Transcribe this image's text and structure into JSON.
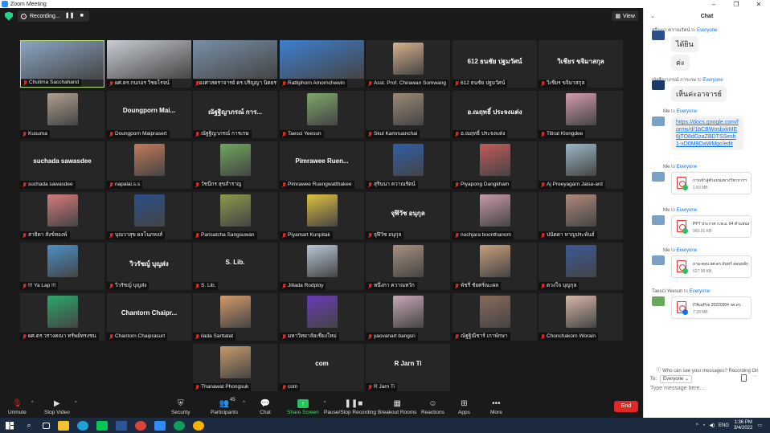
{
  "window": {
    "title": "Zoom Meeting"
  },
  "topbar": {
    "recording_label": "Recording...",
    "view_label": "View"
  },
  "participants": [
    {
      "name": "Chutima Sacchahand",
      "color": "#8aa6c4",
      "active": true
    },
    {
      "name": "ผศ.ดร.กนกอร วิชยโรจน์",
      "color": "#c9cdd4"
    },
    {
      "name": "รองศาสตราจารย์ ดร.ปริญญา นิตยรายา",
      "color": "#7890a8"
    },
    {
      "name": "Rattiphorn Amornchewin",
      "color": "#3d7fd1"
    },
    {
      "name": "Asst. Prof. Chirawan Somwang",
      "color": "#d8b08c"
    },
    {
      "name": "612 ธนชัย ปฐมวัศน์",
      "display": "612 ธนชัย ปฐมวัศน์"
    },
    {
      "name": "วิเชียร ขจิมาสกุล",
      "display": "วิเชียร ขจิมาสกุล"
    },
    {
      "name": "Kusuma",
      "color": "#b0a08e"
    },
    {
      "name": "Doungporn Maiprasert",
      "display": "Doungporn Mai..."
    },
    {
      "name": "ณัฐฐิญาภรณ์ การเกษ",
      "display": "ณัฐฐิญาภรณ์ การ..."
    },
    {
      "name": "Taesci Yeesun",
      "color": "#7fa86a"
    },
    {
      "name": "Skul Kamnuanchai",
      "color": "#9c8a74"
    },
    {
      "name": "อ.ณฤทธิ์ ประจงแต่ง",
      "display": "อ.ณฤทธิ์ ประจงแต่ง"
    },
    {
      "name": "Titirat Klongdee",
      "color": "#d49bb0"
    },
    {
      "name": "suchada sawasdee",
      "display": "suchada sawasdee"
    },
    {
      "name": "napalai.s.s",
      "color": "#c47a5a"
    },
    {
      "name": "วัชนีกร สุขสำราญ",
      "color": "#6fa85c"
    },
    {
      "name": "Pimrawee Ruengwatthakee",
      "display": "Pimrawee Ruen..."
    },
    {
      "name": "สุรินนา ควาณรัตน์",
      "color": "#2f5fa8"
    },
    {
      "name": "Piyapong Dangkham",
      "color": "#c45a5a"
    },
    {
      "name": "Aj Preeyagarn Jaisa-ard",
      "color": "#9bb8c8"
    },
    {
      "name": "สาธิดา สังข์ทองพ์",
      "color": "#d67a7a"
    },
    {
      "name": "บุณวาสุข ผลโนภหงส์",
      "color": "#2a4f8c"
    },
    {
      "name": "Parisatcha Sangsuwan",
      "color": "#8a9a4a"
    },
    {
      "name": "Piyamart Kunpitak",
      "color": "#e0c040"
    },
    {
      "name": "จุฬิวัช อนุกุล",
      "display": "จุฬิวัช อนุกุล"
    },
    {
      "name": "nuchjara boonthanom",
      "color": "#c89aa8"
    },
    {
      "name": "ปนัดดา หาญประพันธ์",
      "color": "#b08a7a"
    },
    {
      "name": "!!! Ya Lap !!!",
      "color": "#4a90c8"
    },
    {
      "name": "วิวรัชญ์ บุญส่ง",
      "display": "วิวรัชญ์ บุญส่ง"
    },
    {
      "name": "S. Lib.",
      "display": "S. Lib."
    },
    {
      "name": "Jitlada Rodploy",
      "color": "#b8c8d8"
    },
    {
      "name": "หนึ่งกา ควาณหวัก",
      "color": "#a89080"
    },
    {
      "name": "พัชรี ชัยศร์ณะผล",
      "color": "#c8a07a"
    },
    {
      "name": "ดวงใจ บุญกุล",
      "color": "#3a5a9a"
    },
    {
      "name": "ผศ.ดร.วรางคณา ทรัพย์ทรงชน",
      "color": "#2aa86a"
    },
    {
      "name": "Chantorn Chaiprasurt",
      "display": "Chantorn Chaipr..."
    },
    {
      "name": "ilada Sarttatat",
      "color": "#d49a6a"
    },
    {
      "name": "มหาวิทยาลัยเชียงใหม่",
      "color": "#6a3ab8"
    },
    {
      "name": "yaovanart bangsri",
      "color": "#c8a8b8"
    },
    {
      "name": "ณัฐฐิณีชาร์ เกาพักษา",
      "color": "#8a6a5a"
    },
    {
      "name": "Chonchakorn Worain",
      "color": "#d8b8a8"
    },
    {
      "name": "Thanawat Phongsuk",
      "color": "#c89a6a"
    },
    {
      "name": "com",
      "display": "com"
    },
    {
      "name": "R Jarn Ti",
      "display": "R Jarn Ti"
    }
  ],
  "toolbar": {
    "unmute": "Unmute",
    "stop_video": "Stop Video",
    "security": "Security",
    "participants": "Participants",
    "participants_count": "45",
    "chat": "Chat",
    "share_screen": "Share Screen",
    "pause_recording": "Pause/Stop Recording",
    "breakout_rooms": "Breakout Rooms",
    "reactions": "Reactions",
    "apps": "Apps",
    "more": "More",
    "end": "End"
  },
  "chat": {
    "title": "Chat",
    "messages": [
      {
        "from": "สุรินนา ควาณรัตน์",
        "to": "to",
        "target": "Everyone",
        "lines": [
          "ได้ยิน",
          "ค่ะ"
        ]
      },
      {
        "from": "ณัฐฐิญาภรณ์ การเกษ",
        "to": "to",
        "target": "Everyone",
        "lines": [
          "เห็นค่ะอาจารย์"
        ]
      },
      {
        "from": "Me",
        "to": "to",
        "target": "Everyone",
        "link": "https://docs.google.com/forms/d/1bCBWosbxkME6jTO8dGzaZBDTSSesh1-xD0M9OaWMgc/edit"
      },
      {
        "from": "Me",
        "to": "to",
        "target": "Everyone",
        "file": "การเข้าสู่ตำแหน่งทางวิชาการฯ",
        "size": "1.83 MB"
      },
      {
        "from": "Me",
        "to": "to",
        "target": "Everyone",
        "file": "PPT ประกาศ ก.พ.อ. 64 ตำแหน่ง",
        "size": "960.01 KB"
      },
      {
        "from": "Me",
        "to": "to",
        "target": "Everyone",
        "file": "ถาม-ตอบ ผศ.ดร.จันทร์ สอนหลัก",
        "size": "627.99 KB"
      },
      {
        "from": "Taesci Yeesun",
        "to": "to",
        "target": "Everyone",
        "file": "ITAcaPos 20220304 รศ.ดร.",
        "size": "7.30 MB"
      }
    ],
    "who_can_see": "Who can see your messages? Recording On",
    "to_label": "To:",
    "to_value": "Everyone",
    "placeholder": "Type message here..."
  },
  "taskbar": {
    "time": "1:36 PM",
    "date": "3/4/2022"
  }
}
